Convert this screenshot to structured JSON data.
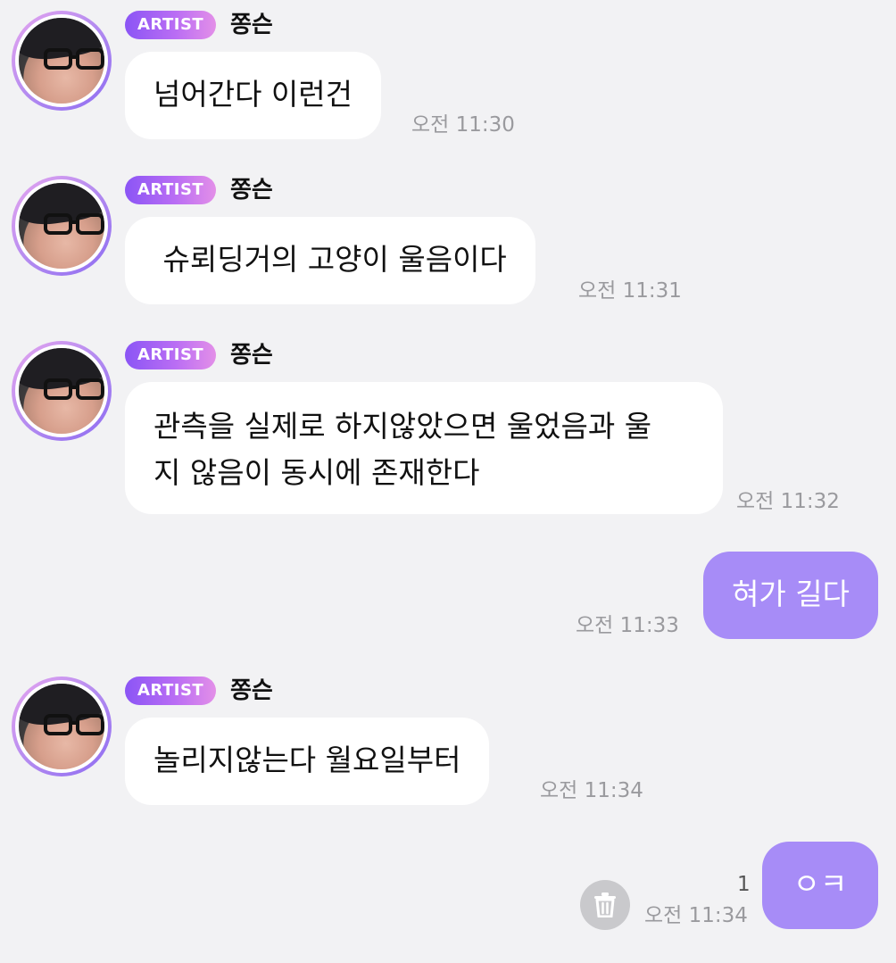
{
  "messages": [
    {
      "badge": "ARTIST",
      "sender": "쫑슨",
      "text": "넘어간다 이런건",
      "time": "오전 11:30"
    },
    {
      "badge": "ARTIST",
      "sender": "쫑슨",
      "text": " 슈뢰딩거의 고양이 울음이다",
      "time": "오전 11:31"
    },
    {
      "badge": "ARTIST",
      "sender": "쫑슨",
      "text_line1": "관측을 실제로 하지않았으면 울었음과 울",
      "text_line2": "지 않음이 동시에 존재한다",
      "time": "오전 11:32"
    },
    {
      "text": "혀가 길다",
      "time": "오전 11:33"
    },
    {
      "badge": "ARTIST",
      "sender": "쫑슨",
      "text": "놀리지않는다 월요일부터",
      "time": "오전 11:34"
    },
    {
      "text": "ㅇㅋ",
      "time": "오전 11:34",
      "unread": "1"
    }
  ],
  "icons": {
    "delete": "trash-icon"
  },
  "colors": {
    "background": "#f2f2f4",
    "outgoing_bubble": "#a78cf7",
    "badge_start": "#8b55f5",
    "badge_end": "#e38fe8",
    "time": "#9a9a9e"
  }
}
